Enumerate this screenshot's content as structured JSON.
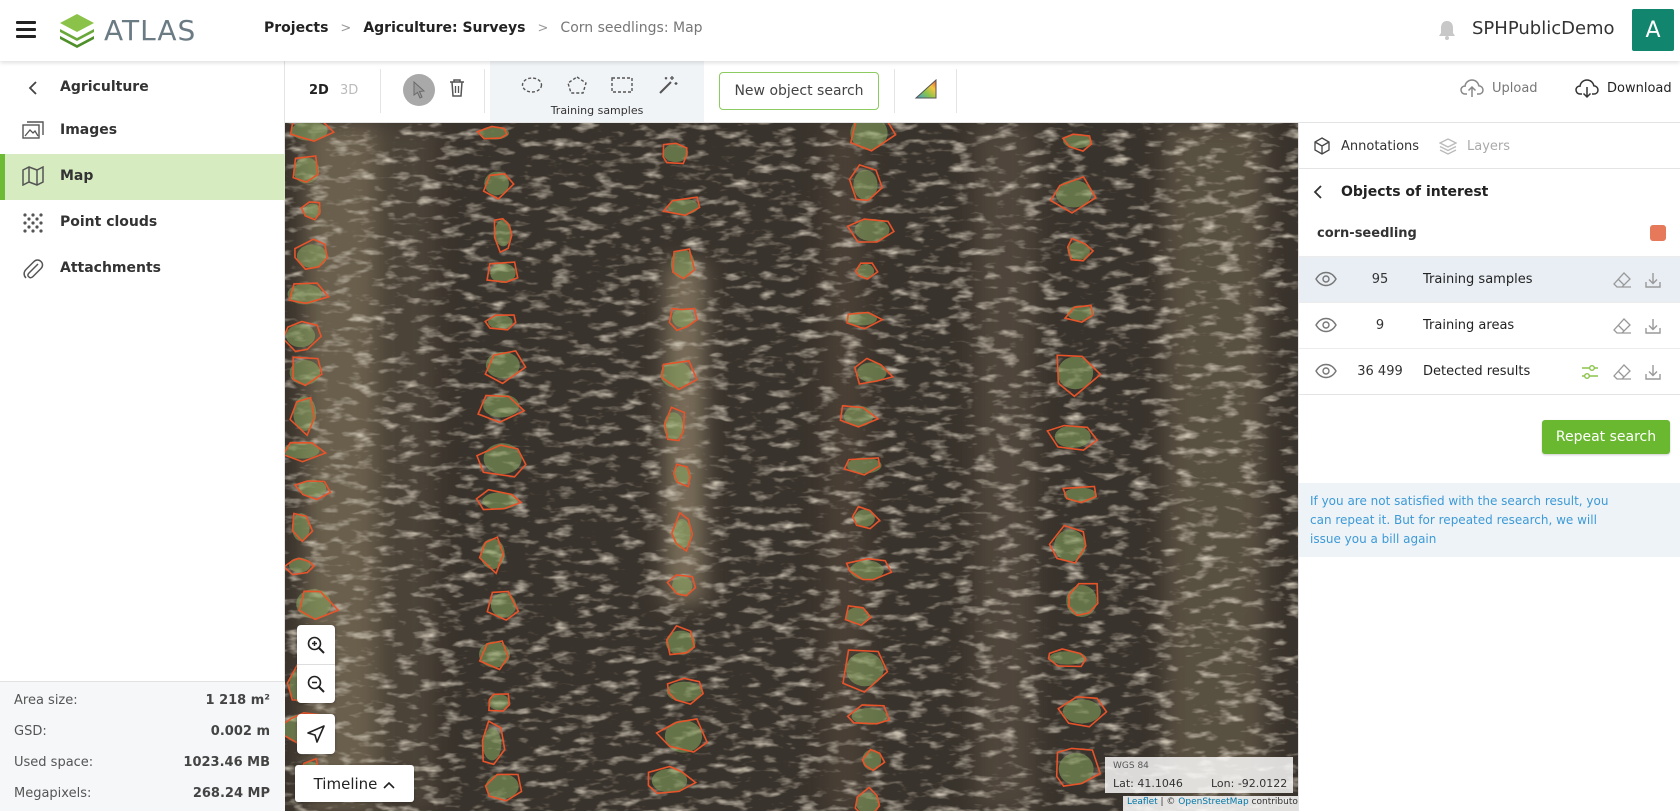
{
  "app": {
    "logo_text": "ATLAS",
    "user_name": "SPHPublicDemo",
    "avatar_letter": "A",
    "accent_color": "#69b82f",
    "avatar_color": "#12856f"
  },
  "breadcrumb": {
    "items": [
      "Projects",
      "Agriculture: Surveys"
    ],
    "current": "Corn seedlings: Map"
  },
  "sidebar": {
    "back_label": "Agriculture",
    "items": [
      {
        "label": "Images",
        "icon": "images-icon"
      },
      {
        "label": "Map",
        "icon": "map-icon",
        "active": true
      },
      {
        "label": "Point clouds",
        "icon": "point-clouds-icon"
      },
      {
        "label": "Attachments",
        "icon": "paperclip-icon"
      }
    ],
    "stats": [
      {
        "label": "Area size:",
        "value": "1 218 m²"
      },
      {
        "label": "GSD:",
        "value": "0.002 m"
      },
      {
        "label": "Used space:",
        "value": "1023.46 MB"
      },
      {
        "label": "Megapixels:",
        "value": "268.24 MP"
      }
    ]
  },
  "toolbar": {
    "mode_2d": "2D",
    "mode_3d": "3D",
    "training_group_label": "Training samples",
    "new_search_label": "New object search",
    "upload_label": "Upload",
    "download_label": "Download"
  },
  "map": {
    "timeline_label": "Timeline",
    "crs": "WGS 84",
    "lat": "Lat: 41.1046",
    "lon": "Lon: -92.0122",
    "attribution_leaflet": "Leaflet",
    "attribution_sep": " | © ",
    "attribution_osm": "OpenStreetMap",
    "attribution_tail": " contributors",
    "polygon_color": "#e8542a"
  },
  "panel": {
    "tabs": [
      {
        "label": "Annotations",
        "active": true
      },
      {
        "label": "Layers",
        "active": false
      }
    ],
    "section_title": "Objects of interest",
    "class_name": "corn-seedling",
    "class_color": "#e6795a",
    "layers": [
      {
        "count": "95",
        "name": "Training samples"
      },
      {
        "count": "9",
        "name": "Training areas"
      },
      {
        "count": "36 499",
        "name": "Detected results"
      }
    ],
    "repeat_label": "Repeat search",
    "notice": "If you are not satisfied with the search result, you can repeat it. But for repeated research, we will issue you a bill again"
  }
}
